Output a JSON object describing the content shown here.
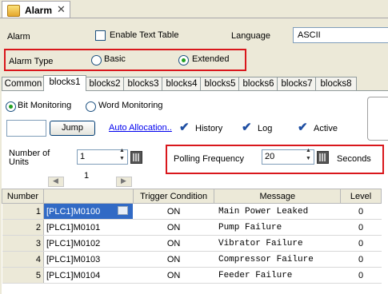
{
  "window": {
    "title": "Alarm",
    "close": "✕"
  },
  "top": {
    "alarm_label": "Alarm",
    "enable_text_table": "Enable Text Table",
    "language_label": "Language",
    "language_value": "ASCII",
    "alarm_type_label": "Alarm Type",
    "basic_label": "Basic",
    "extended_label": "Extended",
    "selected_type": "Extended"
  },
  "tabs": [
    "Common",
    "blocks1",
    "blocks2",
    "blocks3",
    "blocks4",
    "blocks5",
    "blocks6",
    "blocks7",
    "blocks8"
  ],
  "active_tab": "blocks1",
  "monitoring": {
    "bit_label": "Bit Monitoring",
    "word_label": "Word Monitoring",
    "selected": "Bit Monitoring"
  },
  "toolbar": {
    "jump_value": "",
    "jump_label": "Jump",
    "auto_allocation": "Auto Allocation..",
    "history": "History",
    "log": "Log",
    "active": "Active"
  },
  "units": {
    "label_line1": "Number of",
    "label_line2": "Units",
    "value": "1",
    "page": "1"
  },
  "polling": {
    "label": "Polling Frequency",
    "value": "20",
    "unit": "Seconds"
  },
  "table": {
    "headers": [
      "Number",
      "",
      "Trigger Condition",
      "Message",
      "Level"
    ],
    "rows": [
      {
        "num": "1",
        "addr": "[PLC1]M0100",
        "cond": "ON",
        "msg": "Main Power Leaked",
        "level": "0"
      },
      {
        "num": "2",
        "addr": "[PLC1]M0101",
        "cond": "ON",
        "msg": "Pump Failure",
        "level": "0"
      },
      {
        "num": "3",
        "addr": "[PLC1]M0102",
        "cond": "ON",
        "msg": "Vibrator Failure",
        "level": "0"
      },
      {
        "num": "4",
        "addr": "[PLC1]M0103",
        "cond": "ON",
        "msg": "Compressor Failure",
        "level": "0"
      },
      {
        "num": "5",
        "addr": "[PLC1]M0104",
        "cond": "ON",
        "msg": "Feeder Failure",
        "level": "0"
      }
    ]
  },
  "colors": {
    "highlight_border": "#d9171c",
    "selection": "#316ac5",
    "check": "#1f4fa3"
  }
}
